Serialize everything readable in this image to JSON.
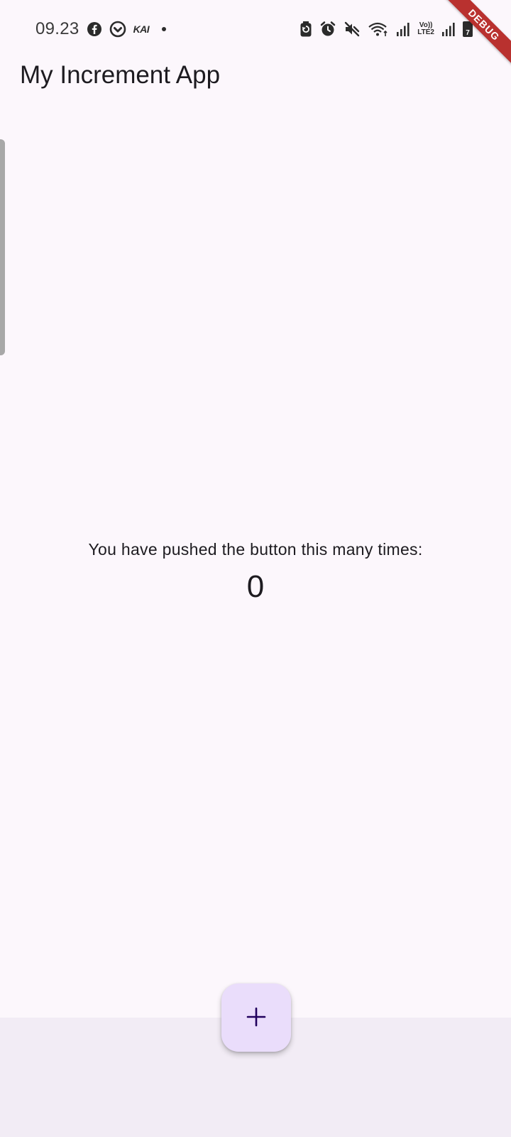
{
  "status_bar": {
    "time": "09.23",
    "left_icons": [
      "facebook-icon",
      "ring-app-icon",
      "kai-app-icon"
    ],
    "kai_label": "KAI",
    "right_icons": [
      "battery-saver-icon",
      "alarm-icon",
      "mute-icon",
      "wifi-icon",
      "signal-icon",
      "volte-icon",
      "signal-icon",
      "battery-icon"
    ],
    "volte_line1": "Vo))",
    "volte_line2": "LTE2",
    "battery_level": "7"
  },
  "debug_banner": {
    "label": "DEBUG",
    "color": "#b9312f"
  },
  "app_bar": {
    "title": "My Increment App"
  },
  "counter": {
    "caption": "You have pushed the button this many times:",
    "value": "0"
  },
  "fab": {
    "icon": "add-icon",
    "color": "#eaddfb",
    "icon_color": "#21005d"
  },
  "colors": {
    "background": "#fcf7fc",
    "bottom_area": "#f2ecf5",
    "text": "#1d1b20"
  }
}
